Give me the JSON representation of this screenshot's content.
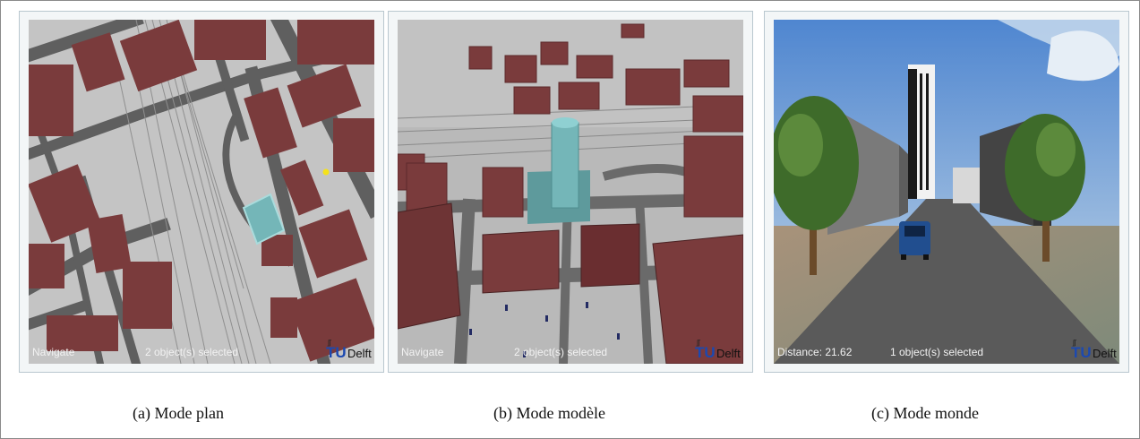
{
  "panels": [
    {
      "status_left": "Navigate",
      "status_selection": "2 object(s) selected",
      "logo_tu": "TU",
      "logo_delft": "Delft",
      "caption": "(a)  Mode plan"
    },
    {
      "status_left": "Navigate",
      "status_selection": "2 object(s) selected",
      "logo_tu": "TU",
      "logo_delft": "Delft",
      "caption": "(b)  Mode modèle"
    },
    {
      "status_left": "Distance: 21.62",
      "status_selection": "1 object(s) selected",
      "logo_tu": "TU",
      "logo_delft": "Delft",
      "caption": "(c)  Mode monde"
    }
  ],
  "colors": {
    "building": "#7a3b3c",
    "ground": "#c4c4c4",
    "road": "#5f5f5f",
    "selected": "#74b6b8",
    "sky": "#5a8ed3",
    "tree": "#3e6b2a"
  }
}
